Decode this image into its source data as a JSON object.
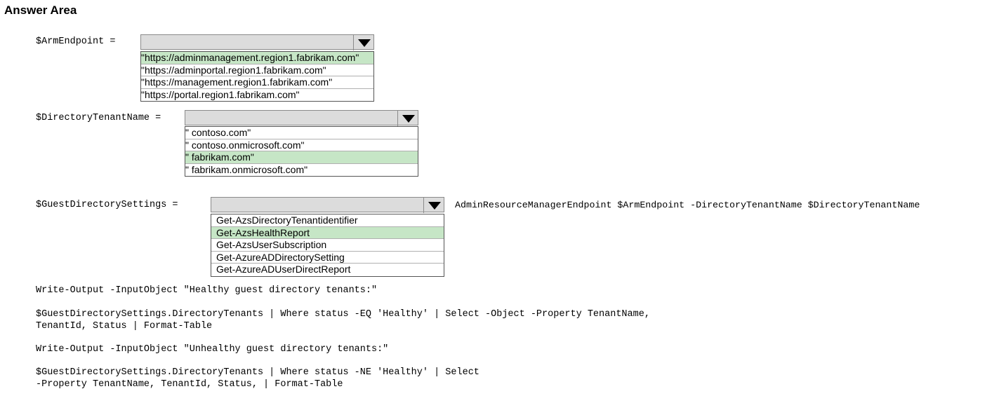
{
  "title": "Answer Area",
  "colors": {
    "selected_option": "#c6e6c6",
    "dropdown_header": "#dcdcdc"
  },
  "arm": {
    "label": "$ArmEndpoint =",
    "options": [
      "\"https://adminmanagement.region1.fabrikam.com\"",
      "\"https://adminportal.region1.fabrikam.com\"",
      "\"https://management.region1.fabrikam.com\"",
      "\"https://portal.region1.fabrikam.com\""
    ],
    "selected_index": 0
  },
  "tenant": {
    "label": "$DirectoryTenantName =",
    "options": [
      "\" contoso.com\"",
      "\" contoso.onmicrosoft.com\"",
      "\" fabrikam.com\"",
      "\" fabrikam.onmicrosoft.com\""
    ],
    "selected_index": 2
  },
  "guest": {
    "label": "$GuestDirectorySettings =",
    "suffix": "AdminResourceManagerEndpoint $ArmEndpoint -DirectoryTenantName $DirectoryTenantName",
    "options": [
      "Get-AzsDirectoryTenantidentifier",
      "Get-AzsHealthReport",
      "Get-AzsUserSubscription",
      "Get-AzureADDirectorySetting",
      "Get-AzureADUserDirectReport"
    ],
    "selected_index": 1
  },
  "code": {
    "line1": "Write-Output -InputObject \"Healthy guest directory tenants:\"",
    "line2a": "$GuestDirectorySettings.DirectoryTenants | Where status -EQ 'Healthy' | Select -Object -Property TenantName,",
    "line2b": "TenantId, Status | Format-Table",
    "line3": "Write-Output -InputObject \"Unhealthy guest directory tenants:\"",
    "line4a": "$GuestDirectorySettings.DirectoryTenants | Where status -NE 'Healthy' | Select",
    "line4b": "-Property TenantName, TenantId, Status, | Format-Table"
  }
}
